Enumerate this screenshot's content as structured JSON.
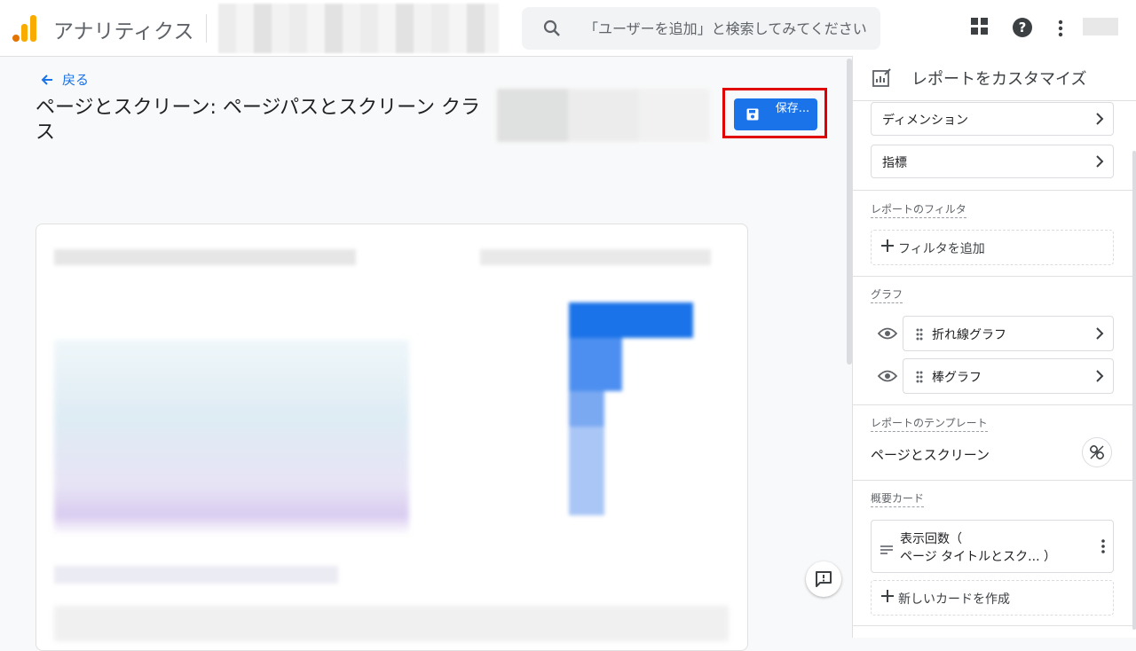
{
  "header": {
    "app_title": "アナリティクス",
    "search_placeholder": "「ユーザーを追加」と検索してみてください"
  },
  "page": {
    "back_label": "戻る",
    "title": "ページとスクリーン: ページパスとスクリーン クラス",
    "save_label": "保存..."
  },
  "panel": {
    "title": "レポートをカスタマイズ",
    "dimension_label": "ディメンション",
    "metrics_label": "指標",
    "filter_section": "レポートのフィルタ",
    "add_filter": "フィルタを追加",
    "graph_section": "グラフ",
    "graphs": [
      "折れ線グラフ",
      "棒グラフ"
    ],
    "template_section": "レポートのテンプレート",
    "template_name": "ページとスクリーン",
    "summary_section": "概要カード",
    "summary_card_line1": "表示回数（",
    "summary_card_line2": "ページ タイトルとスク... ）",
    "new_card": "新しいカードを作成"
  },
  "colors": {
    "accent": "#1a73e8",
    "highlight_border": "#e00000"
  }
}
